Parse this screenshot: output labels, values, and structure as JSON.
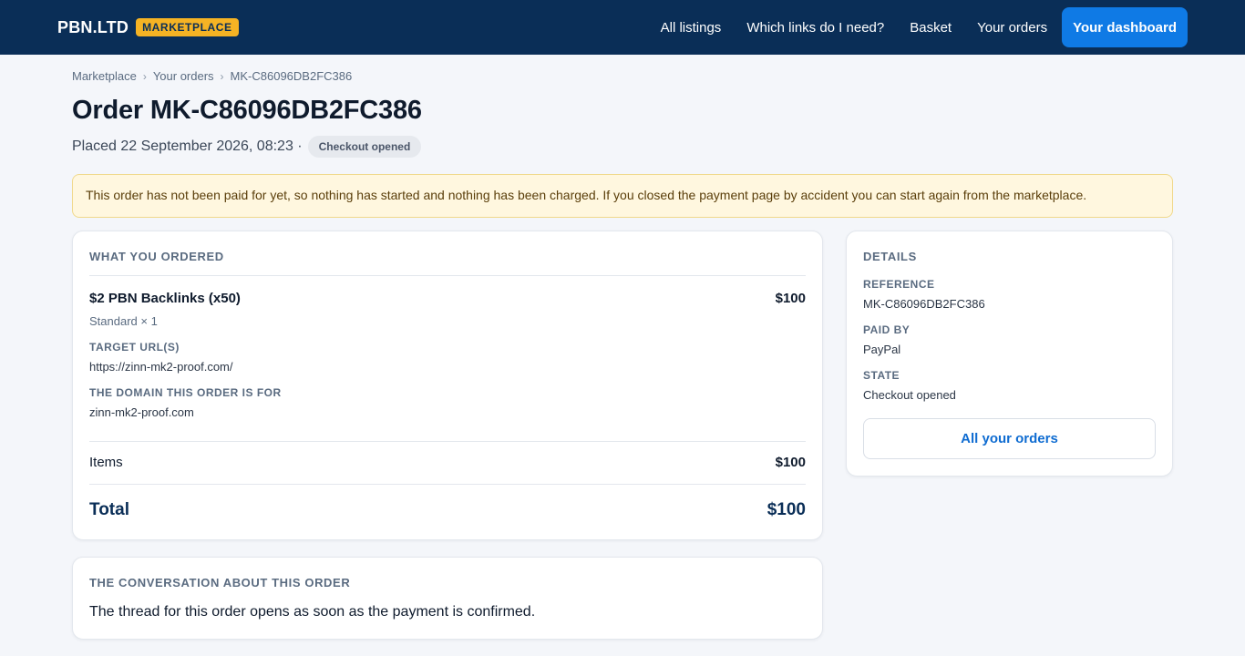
{
  "header": {
    "brand": "PBN.LTD",
    "badge": "MARKETPLACE",
    "nav": [
      "All listings",
      "Which links do I need?",
      "Basket",
      "Your orders"
    ],
    "cta": "Your dashboard"
  },
  "breadcrumb": [
    "Marketplace",
    "Your orders",
    "MK-C86096DB2FC386"
  ],
  "page": {
    "title": "Order MK-C86096DB2FC386",
    "placed": "Placed 22 September 2026, 08:23 ·",
    "status": "Checkout opened"
  },
  "notice": "This order has not been paid for yet, so nothing has started and nothing has been charged. If you closed the payment page by accident you can start again from the marketplace.",
  "order": {
    "heading": "WHAT YOU ORDERED",
    "item_name": "$2 PBN Backlinks (x50)",
    "item_price": "$100",
    "item_sub": "Standard × 1",
    "target_label": "TARGET URL(S)",
    "target_value": "https://zinn-mk2-proof.com/",
    "domain_label": "THE DOMAIN THIS ORDER IS FOR",
    "domain_value": "zinn-mk2-proof.com",
    "items_label": "Items",
    "items_value": "$100",
    "total_label": "Total",
    "total_value": "$100"
  },
  "conversation": {
    "heading": "THE CONVERSATION ABOUT THIS ORDER",
    "text": "The thread for this order opens as soon as the payment is confirmed."
  },
  "details": {
    "heading": "DETAILS",
    "reference_label": "REFERENCE",
    "reference_value": "MK-C86096DB2FC386",
    "paid_label": "PAID BY",
    "paid_value": "PayPal",
    "state_label": "STATE",
    "state_value": "Checkout opened",
    "button": "All your orders"
  },
  "colors": {
    "header_bg": "#0a2e57",
    "badge_bg": "#f5b324",
    "cta_bg": "#0f7ae5",
    "notice_bg": "#fff7df",
    "link": "#0f6cd1"
  }
}
